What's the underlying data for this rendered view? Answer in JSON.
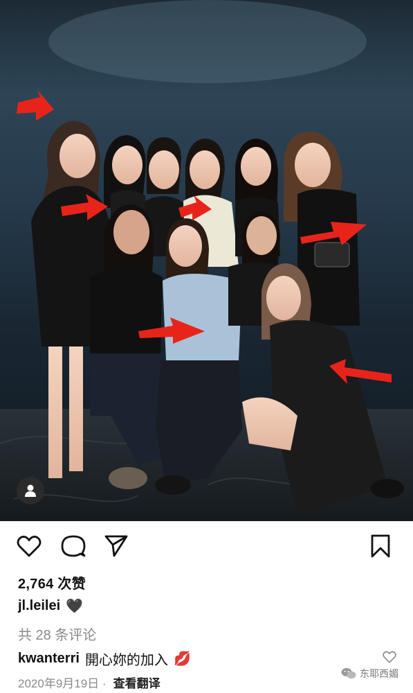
{
  "post": {
    "likes": "2,764 次赞",
    "owner_username": "jl.leilei",
    "owner_emoji": "🖤",
    "comments_link": "共 28 条评论",
    "top_comment": {
      "username": "kwanterri",
      "text": "開心妳的加入",
      "emoji": "💋"
    },
    "date": "2020年9月19日 ·",
    "translate": "查看翻译"
  },
  "actions": {
    "like_icon": "heart-icon",
    "comment_icon": "comment-icon",
    "share_icon": "send-icon",
    "save_icon": "bookmark-icon"
  },
  "watermark": "东耶西媚",
  "colors": {
    "arrow_red": "#e8241a",
    "secondary_text": "#8a8a8a"
  }
}
